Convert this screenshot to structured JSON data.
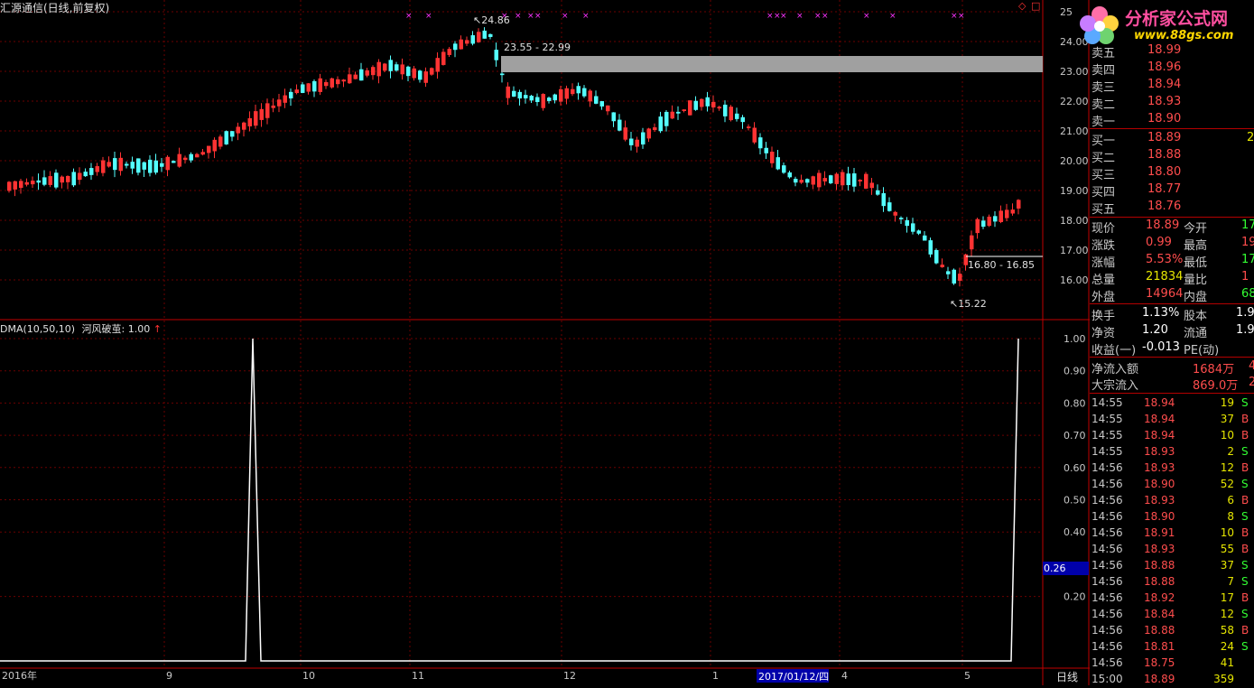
{
  "header": {
    "title": "汇源通信(日线,前复权)",
    "indicator_label": "DMA(10,50,10)",
    "indicator_value": "河风破茧: 1.00",
    "diamond": "◇",
    "square": "□"
  },
  "logo": {
    "name": "分析家公式网",
    "url": "www.88gs.com"
  },
  "annotations": {
    "high": "24.86",
    "band": "23.55 - 22.99",
    "low": "15.22",
    "range2": "16.80 - 16.85",
    "cursor_value": "0.26",
    "cursor_date": "2017/01/12/四",
    "period": "日线"
  },
  "price_axis": [
    "25",
    "24.00",
    "23.00",
    "22.00",
    "21.00",
    "20.00",
    "19.00",
    "18.00",
    "17.00",
    "16.00"
  ],
  "indicator_axis": [
    "1.00",
    "0.90",
    "0.80",
    "0.70",
    "0.60",
    "0.50",
    "0.40",
    "0.20"
  ],
  "time_axis": [
    "2016年",
    "9",
    "10",
    "11",
    "12",
    "1",
    "4",
    "5"
  ],
  "orderbook": {
    "asks": [
      {
        "label": "卖五",
        "price": "18.99"
      },
      {
        "label": "卖四",
        "price": "18.96"
      },
      {
        "label": "卖三",
        "price": "18.94"
      },
      {
        "label": "卖二",
        "price": "18.93"
      },
      {
        "label": "卖一",
        "price": "18.90"
      }
    ],
    "bids": [
      {
        "label": "买一",
        "price": "18.89",
        "vol": "2"
      },
      {
        "label": "买二",
        "price": "18.88",
        "vol": ""
      },
      {
        "label": "买三",
        "price": "18.80",
        "vol": ""
      },
      {
        "label": "买四",
        "price": "18.77",
        "vol": ""
      },
      {
        "label": "买五",
        "price": "18.76",
        "vol": ""
      }
    ]
  },
  "quote": [
    {
      "l1": "现价",
      "v1": "18.89",
      "c1": "red",
      "l2": "今开",
      "v2": "17",
      "c2": "green"
    },
    {
      "l1": "涨跌",
      "v1": "0.99",
      "c1": "red",
      "l2": "最高",
      "v2": "19",
      "c2": "red"
    },
    {
      "l1": "涨幅",
      "v1": "5.53%",
      "c1": "red",
      "l2": "最低",
      "v2": "17",
      "c2": "green"
    },
    {
      "l1": "总量",
      "v1": "21834",
      "c1": "yellow",
      "l2": "量比",
      "v2": "1",
      "c2": "red"
    },
    {
      "l1": "外盘",
      "v1": "14964",
      "c1": "red",
      "l2": "内盘",
      "v2": "68",
      "c2": "green"
    }
  ],
  "stats": [
    {
      "l1": "换手",
      "v1": "1.13%",
      "l2": "股本",
      "v2": "1.9"
    },
    {
      "l1": "净资",
      "v1": "1.20",
      "l2": "流通",
      "v2": "1.9"
    },
    {
      "l1": "收益(一)",
      "v1": "-0.013",
      "l2": "PE(动)",
      "v2": ""
    }
  ],
  "flows": [
    {
      "label": "净流入额",
      "value": "1684万",
      "extra": "4"
    },
    {
      "label": "大宗流入",
      "value": "869.0万",
      "extra": "2"
    }
  ],
  "trades": [
    {
      "time": "14:55",
      "price": "18.94",
      "vol": "19",
      "side": "S"
    },
    {
      "time": "14:55",
      "price": "18.94",
      "vol": "37",
      "side": "B"
    },
    {
      "time": "14:55",
      "price": "18.94",
      "vol": "10",
      "side": "B"
    },
    {
      "time": "14:55",
      "price": "18.93",
      "vol": "2",
      "side": "S"
    },
    {
      "time": "14:56",
      "price": "18.93",
      "vol": "12",
      "side": "B"
    },
    {
      "time": "14:56",
      "price": "18.90",
      "vol": "52",
      "side": "S"
    },
    {
      "time": "14:56",
      "price": "18.93",
      "vol": "6",
      "side": "B"
    },
    {
      "time": "14:56",
      "price": "18.90",
      "vol": "8",
      "side": "S"
    },
    {
      "time": "14:56",
      "price": "18.91",
      "vol": "10",
      "side": "B"
    },
    {
      "time": "14:56",
      "price": "18.93",
      "vol": "55",
      "side": "B"
    },
    {
      "time": "14:56",
      "price": "18.88",
      "vol": "37",
      "side": "S"
    },
    {
      "time": "14:56",
      "price": "18.88",
      "vol": "7",
      "side": "S"
    },
    {
      "time": "14:56",
      "price": "18.92",
      "vol": "17",
      "side": "B"
    },
    {
      "time": "14:56",
      "price": "18.84",
      "vol": "12",
      "side": "S"
    },
    {
      "time": "14:56",
      "price": "18.88",
      "vol": "58",
      "side": "B"
    },
    {
      "time": "14:56",
      "price": "18.81",
      "vol": "24",
      "side": "S"
    },
    {
      "time": "14:56",
      "price": "18.75",
      "vol": "41",
      "side": ""
    },
    {
      "time": "15:00",
      "price": "18.89",
      "vol": "359",
      "side": ""
    }
  ],
  "colors": {
    "up": "#ff3333",
    "down": "#54ffff",
    "grid": "#8b0000",
    "signal": "#ff33ff"
  }
}
